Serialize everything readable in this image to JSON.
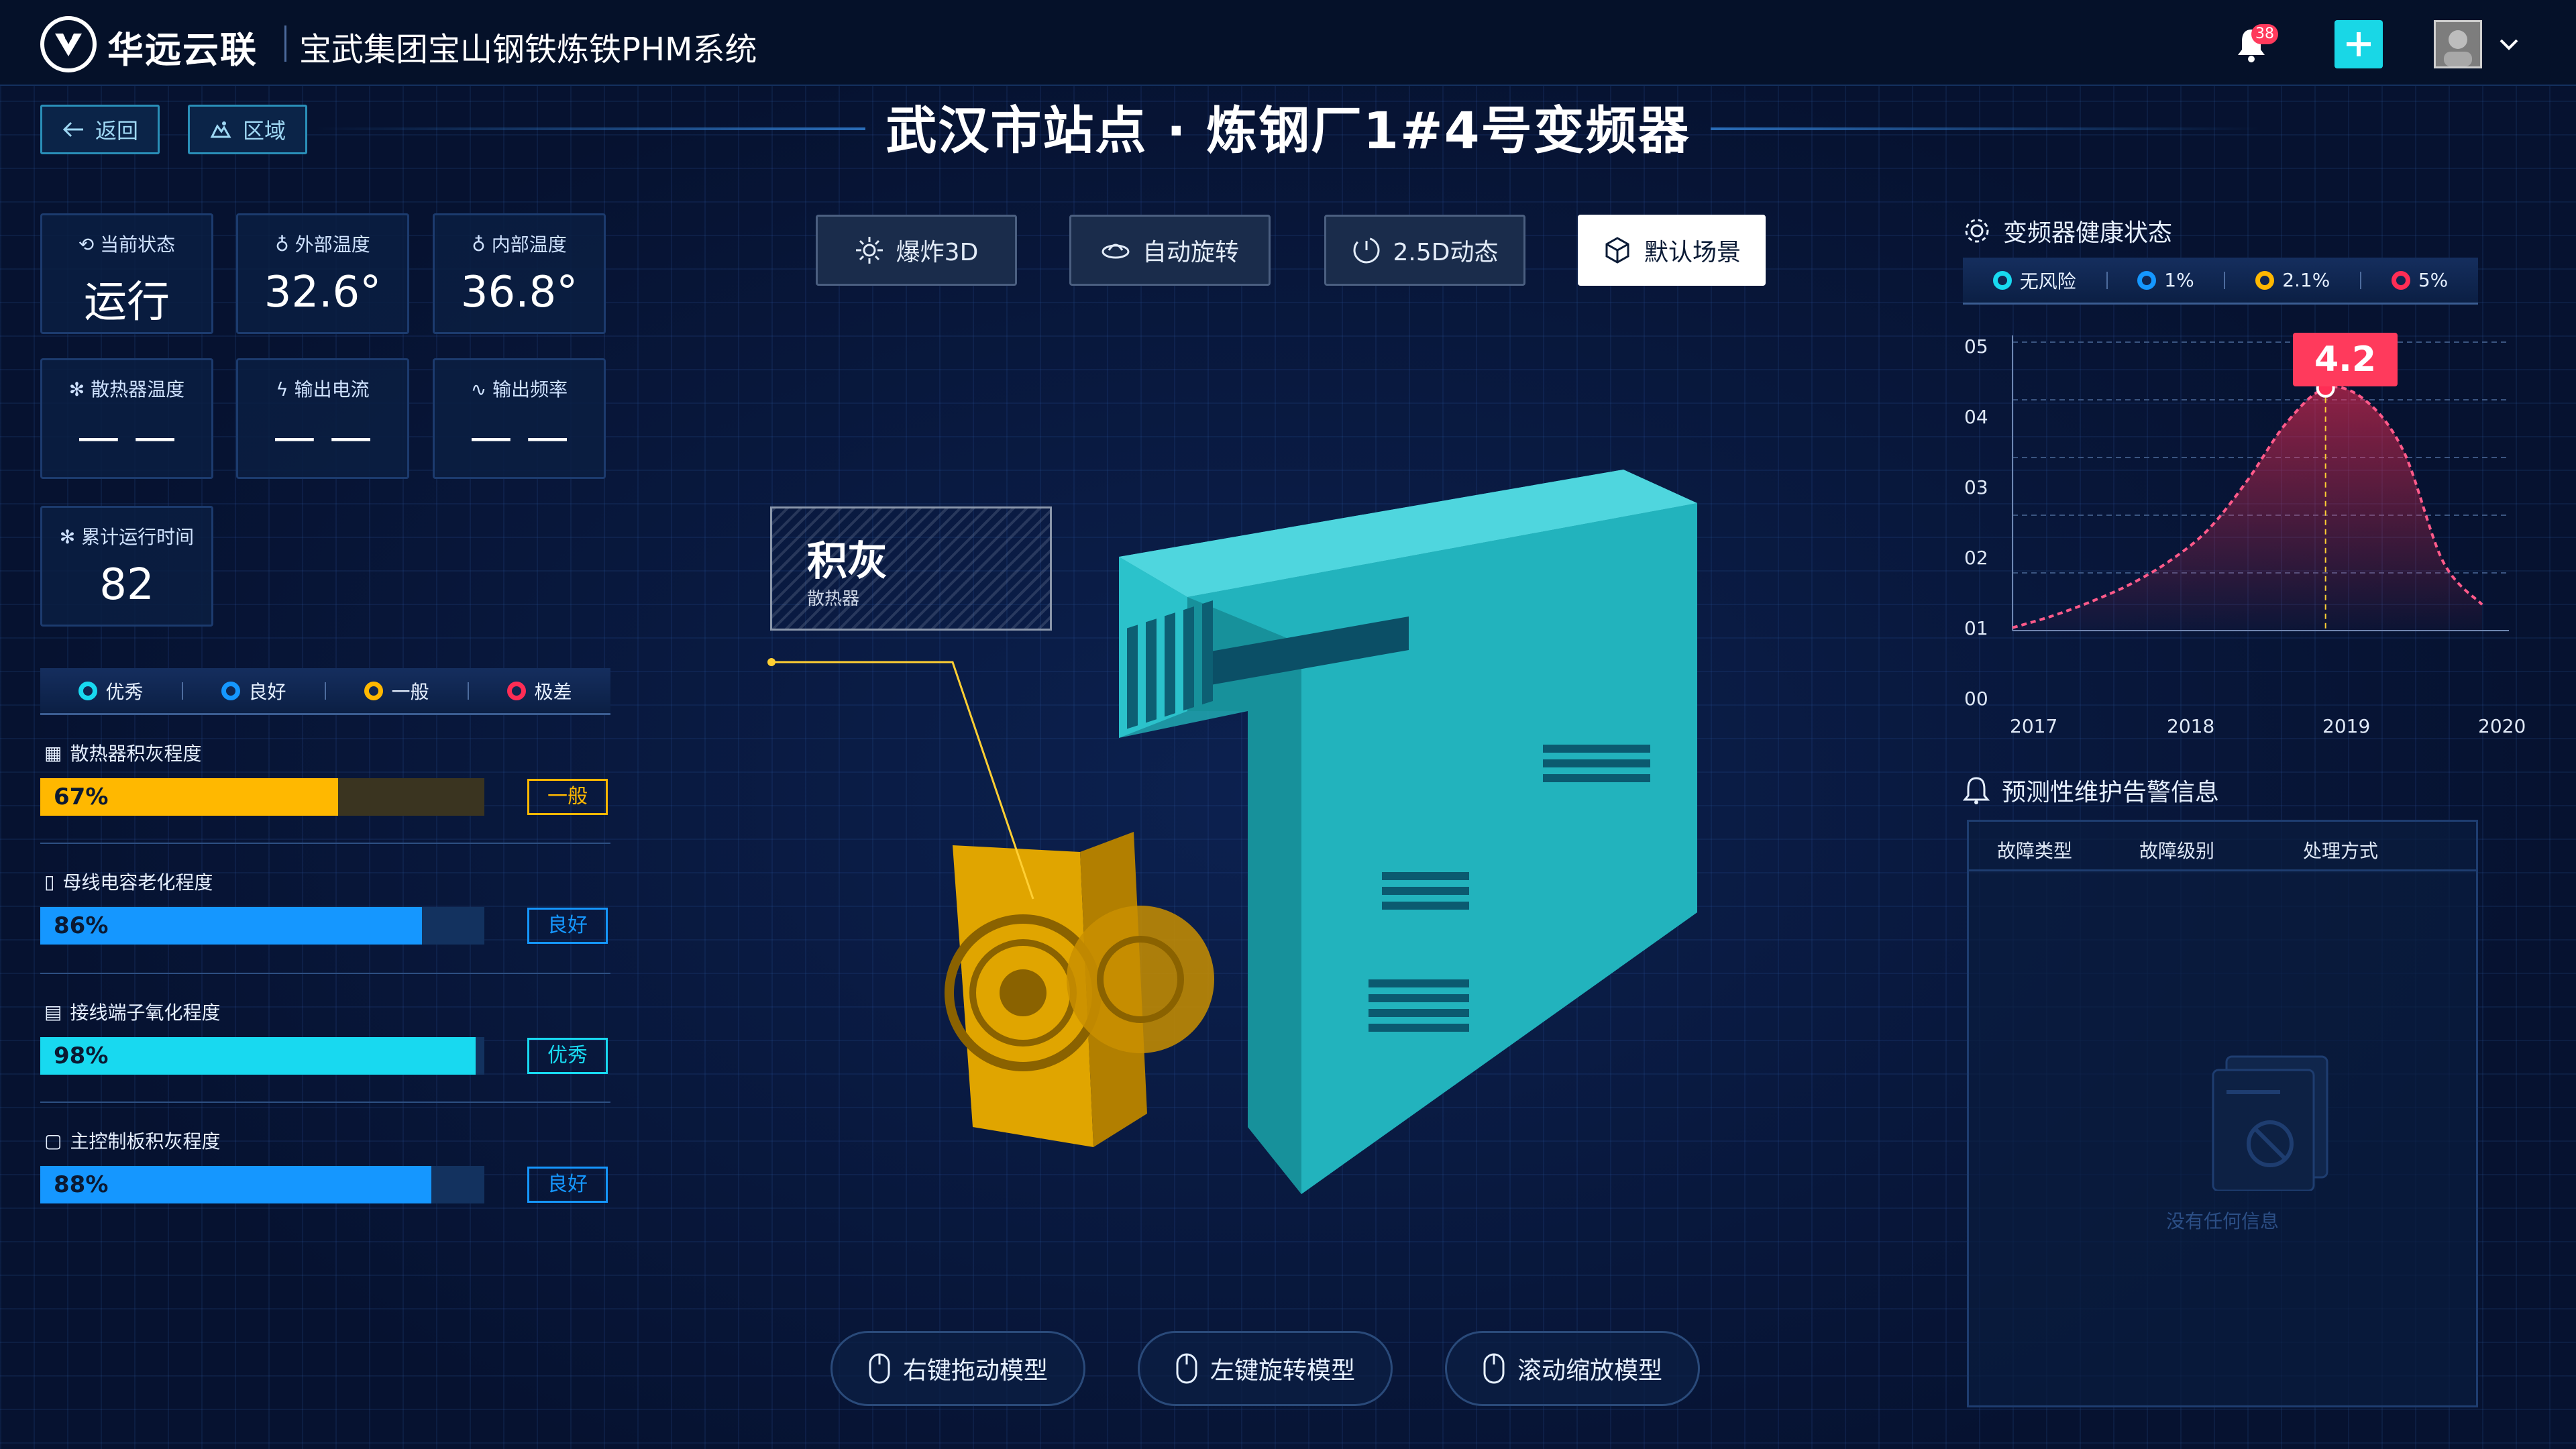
{
  "header": {
    "brand": "华远云联",
    "system_title": "宝武集团宝山钢铁炼铁PHM系统",
    "notification_count": "38"
  },
  "nav": {
    "back_label": "返回",
    "region_label": "区域"
  },
  "page_title": "武汉市站点 · 炼钢厂1#4号变频器",
  "metrics": [
    {
      "label": "当前状态",
      "value": "运行",
      "icon": "status-icon"
    },
    {
      "label": "外部温度",
      "value": "32.6°",
      "icon": "thermometer-icon"
    },
    {
      "label": "内部温度",
      "value": "36.8°",
      "icon": "thermometer-icon"
    },
    {
      "label": "散热器温度",
      "value": "— —",
      "icon": "fan-icon"
    },
    {
      "label": "输出电流",
      "value": "— —",
      "icon": "lightning-icon"
    },
    {
      "label": "输出频率",
      "value": "— —",
      "icon": "wave-icon"
    },
    {
      "label": "累计运行时间",
      "value": "82",
      "icon": "fan-icon"
    }
  ],
  "grade_legend": [
    {
      "label": "优秀",
      "color": "#18d9f0"
    },
    {
      "label": "良好",
      "color": "#1597ff"
    },
    {
      "label": "一般",
      "color": "#ffb800"
    },
    {
      "label": "极差",
      "color": "#ff2d55"
    }
  ],
  "conditions": [
    {
      "title": "散热器积灰程度",
      "percent": "67%",
      "value": 0.67,
      "grade": "一般",
      "color": "#ffb800"
    },
    {
      "title": "母线电容老化程度",
      "percent": "86%",
      "value": 0.86,
      "grade": "良好",
      "color": "#1597ff"
    },
    {
      "title": "接线端子氧化程度",
      "percent": "98%",
      "value": 0.98,
      "grade": "优秀",
      "color": "#18d9f0"
    },
    {
      "title": "主控制板积灰程度",
      "percent": "88%",
      "value": 0.88,
      "grade": "良好",
      "color": "#1597ff"
    }
  ],
  "modes": [
    {
      "label": "爆炸3D",
      "active": false
    },
    {
      "label": "自动旋转",
      "active": false
    },
    {
      "label": "2.5D动态",
      "active": false
    },
    {
      "label": "默认场景",
      "active": true
    }
  ],
  "annotation": {
    "title": "积灰",
    "subtitle": "散热器"
  },
  "hints": [
    {
      "label": "右键拖动模型"
    },
    {
      "label": "左键旋转模型"
    },
    {
      "label": "滚动缩放模型"
    }
  ],
  "health": {
    "title": "变频器健康状态",
    "legend": [
      {
        "label": "无风险",
        "color": "#18d9f0"
      },
      {
        "label": "1%",
        "color": "#1597ff"
      },
      {
        "label": "2.1%",
        "color": "#ffb800"
      },
      {
        "label": "5%",
        "color": "#ff2d55"
      }
    ]
  },
  "chart_data": {
    "type": "area",
    "x": [
      2017,
      2018,
      2019,
      2020
    ],
    "x_ticks": [
      "2017",
      "2018",
      "2019",
      "2020"
    ],
    "y_ticks": [
      "00",
      "01",
      "02",
      "03",
      "04",
      "05"
    ],
    "ylim": [
      0,
      5
    ],
    "series": [
      {
        "x": [
          2017.0,
          2017.25,
          2017.5,
          2017.75,
          2018.0,
          2018.25,
          2018.5,
          2018.75,
          2019.0,
          2019.25,
          2019.5,
          2019.75,
          2020.0
        ],
        "values": [
          0.05,
          0.25,
          0.5,
          0.8,
          1.2,
          1.75,
          2.6,
          3.6,
          4.2,
          4.0,
          3.1,
          1.2,
          0.45
        ]
      }
    ],
    "highlight": {
      "x": 2019.0,
      "value": "4.2"
    },
    "grid": true
  },
  "alerts": {
    "title": "预测性维护告警信息",
    "columns": [
      "故障类型",
      "故障级别",
      "处理方式"
    ],
    "empty_text": "没有任何信息"
  }
}
